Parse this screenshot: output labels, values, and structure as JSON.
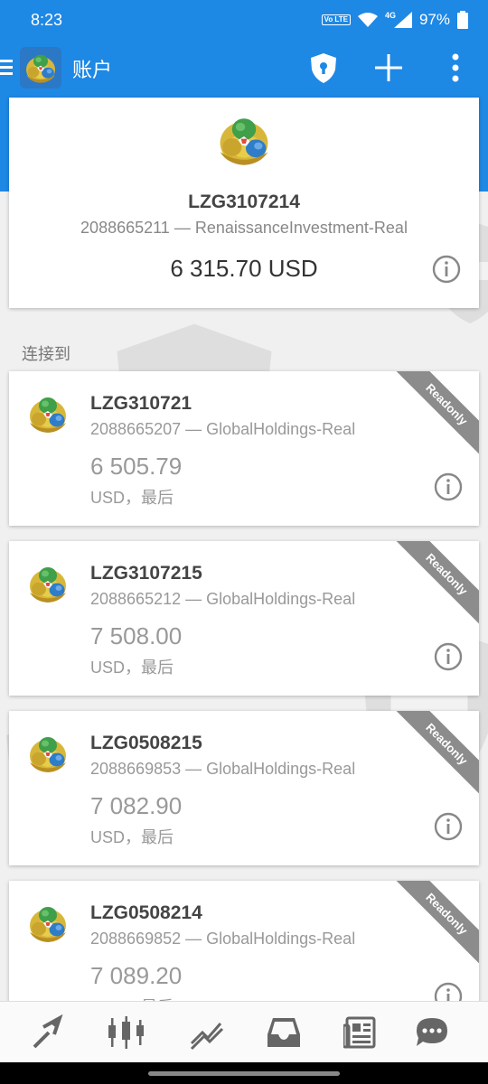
{
  "status_bar": {
    "time": "8:23",
    "volte": "Vo LTE",
    "network": "4G",
    "battery": "97%"
  },
  "app_bar": {
    "title": "账户"
  },
  "main_account": {
    "login": "LZG3107214",
    "server_line": "2088665211 — RenaissanceInvestment-Real",
    "balance": "6 315.70 USD"
  },
  "section_label": "连接到",
  "accounts": [
    {
      "login": "LZG310721",
      "server_line": "2088665207 — GlobalHoldings-Real",
      "balance": "6 505.79",
      "currency_line": "USD，最后",
      "badge": "Readonly"
    },
    {
      "login": "LZG3107215",
      "server_line": "2088665212 — GlobalHoldings-Real",
      "balance": "7 508.00",
      "currency_line": "USD，最后",
      "badge": "Readonly"
    },
    {
      "login": "LZG0508215",
      "server_line": "2088669853 — GlobalHoldings-Real",
      "balance": "7 082.90",
      "currency_line": "USD，最后",
      "badge": "Readonly"
    },
    {
      "login": "LZG0508214",
      "server_line": "2088669852 — GlobalHoldings-Real",
      "balance": "7 089.20",
      "currency_line": "USD，最后",
      "badge": "Readonly"
    }
  ],
  "bottom_nav": [
    "quotes-icon",
    "chart-icon",
    "trade-icon",
    "history-icon",
    "news-icon",
    "chat-icon"
  ],
  "colors": {
    "primary": "#1e88e5",
    "ribbon": "#8c8c8c",
    "background": "#f0f0f0"
  }
}
